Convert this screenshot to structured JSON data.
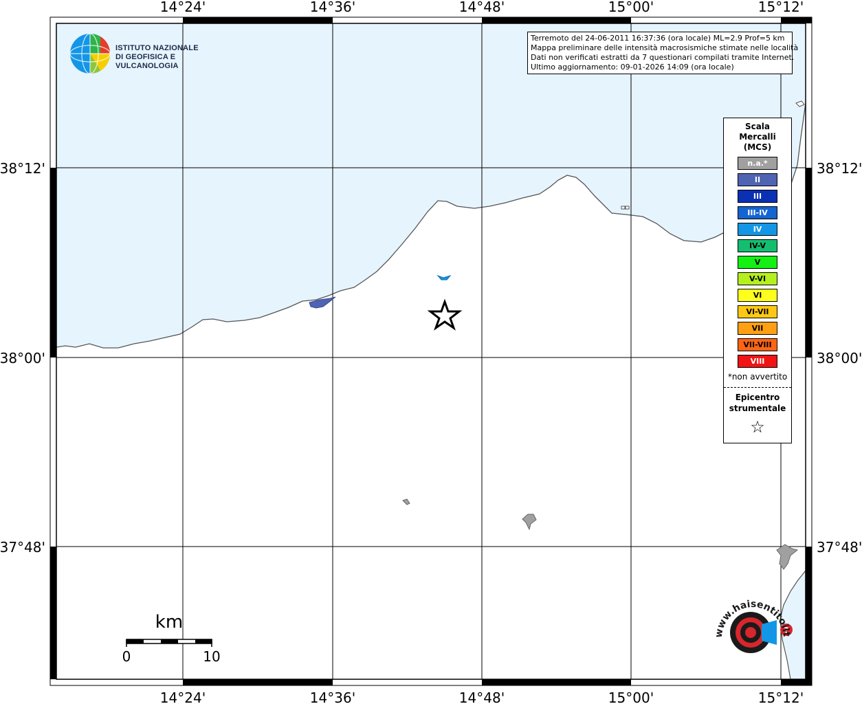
{
  "map": {
    "lon_labels": [
      "14°24'",
      "14°36'",
      "14°48'",
      "15°00'",
      "15°12'"
    ],
    "lat_labels": [
      "38°12'",
      "38°00'",
      "37°48'"
    ],
    "colors": {
      "sea": "#e6f4fe",
      "land": "#ffffff",
      "coast": "#555555",
      "grid": "#000000"
    }
  },
  "info": {
    "line1": "Terremoto del 24-06-2011 16:37:36 (ora locale) ML=2.9 Prof=5 km",
    "line2": "Mappa preliminare delle intensità macrosismiche stimate nelle località",
    "line3": "Dati non verificati estratti da 7 questionari compilati tramite Internet.",
    "line4": "Ultimo aggiornamento: 09-01-2026 14:09 (ora locale)"
  },
  "legend": {
    "title_line1": "Scala",
    "title_line2": "Mercalli",
    "title_line3": "(MCS)",
    "items": [
      {
        "label": "n.a.*",
        "color": "#a0a0a0",
        "text_color": "#ffffff"
      },
      {
        "label": "II",
        "color": "#5064b4",
        "text_color": "#ffffff"
      },
      {
        "label": "III",
        "color": "#0a30b4",
        "text_color": "#ffffff"
      },
      {
        "label": "III-IV",
        "color": "#1464d2",
        "text_color": "#ffffff"
      },
      {
        "label": "IV",
        "color": "#1496e6",
        "text_color": "#ffffff"
      },
      {
        "label": "IV-V",
        "color": "#14be6e",
        "text_color": "#000000"
      },
      {
        "label": "V",
        "color": "#14f014",
        "text_color": "#000000"
      },
      {
        "label": "V-VI",
        "color": "#b4f01e",
        "text_color": "#000000"
      },
      {
        "label": "VI",
        "color": "#ffff1e",
        "text_color": "#000000"
      },
      {
        "label": "VI-VII",
        "color": "#ffc814",
        "text_color": "#000000"
      },
      {
        "label": "VII",
        "color": "#ffa014",
        "text_color": "#000000"
      },
      {
        "label": "VII-VIII",
        "color": "#ff6414",
        "text_color": "#000000"
      },
      {
        "label": "VIII",
        "color": "#f01414",
        "text_color": "#ffffff"
      }
    ],
    "note": "*non avvertito",
    "epicenter_line1": "Epicentro",
    "epicenter_line2": "strumentale",
    "star_icon": "☆"
  },
  "scale_bar": {
    "unit": "km",
    "min_label": "0",
    "max_label": "10"
  },
  "logos": {
    "ingv_line1": "ISTITUTO NAZIONALE",
    "ingv_line2": "DI GEOFISICA E VULCANOLOGIA",
    "hst_text": "www.haisentitoilterremoto.it",
    "hst_colors": {
      "red": "#d7262c",
      "dark": "#1a1a1a",
      "blue": "#1496e6"
    }
  },
  "observations": [
    {
      "intensity": "II",
      "color": "#5064b4"
    },
    {
      "intensity": "IV",
      "color": "#1496e6"
    },
    {
      "intensity": "n.a.*",
      "color": "#a0a0a0"
    },
    {
      "intensity": "n.a.*",
      "color": "#a0a0a0"
    },
    {
      "intensity": "n.a.*",
      "color": "#a0a0a0"
    }
  ]
}
